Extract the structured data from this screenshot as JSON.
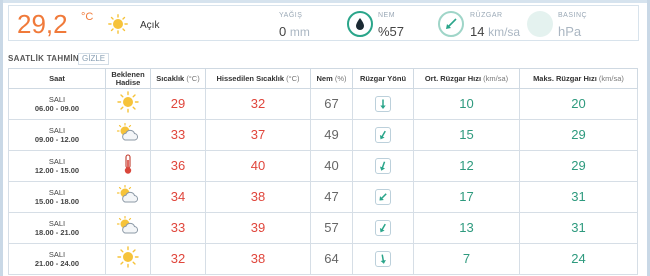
{
  "current": {
    "temperature": "29,2",
    "unit": "°C",
    "condition": "Açık",
    "rain": {
      "label": "YAĞIŞ",
      "value": "0",
      "unit": "mm"
    },
    "humidity": {
      "label": "NEM",
      "value": "%57"
    },
    "wind": {
      "label": "RÜZGAR",
      "value": "14",
      "unit": "km/sa"
    },
    "pressure": {
      "label": "BASINÇ",
      "value": "hPa"
    }
  },
  "forecast": {
    "title": "SAATLİK TAHMİN",
    "hide_label": "GİZLE",
    "headers": {
      "time": "Saat",
      "event_line1": "Beklenen",
      "event_line2": "Hadise",
      "temp": "Sıcaklık",
      "temp_unit": "(°C)",
      "feels": "Hissedilen Sıcaklık",
      "feels_unit": "(°C)",
      "humidity": "Nem",
      "humidity_unit": "(%)",
      "wind_dir": "Rüzgar Yönü",
      "avg_wind": "Ort. Rüzgar Hızı",
      "avg_wind_unit": "(km/sa)",
      "max_wind": "Maks. Rüzgar Hızı",
      "max_wind_unit": "(km/sa)"
    },
    "rows": [
      {
        "day": "SALI",
        "time": "06.00 - 09.00",
        "icon": "sun-icon",
        "temp": "29",
        "feels": "32",
        "humidity": "67",
        "wind_dir_deg": 180,
        "avg": "10",
        "max": "20"
      },
      {
        "day": "SALI",
        "time": "09.00 - 12.00",
        "icon": "partly-cloudy-icon",
        "temp": "33",
        "feels": "37",
        "humidity": "49",
        "wind_dir_deg": 210,
        "avg": "15",
        "max": "29"
      },
      {
        "day": "SALI",
        "time": "12.00 - 15.00",
        "icon": "thermometer-icon",
        "temp": "36",
        "feels": "40",
        "humidity": "40",
        "wind_dir_deg": 200,
        "avg": "12",
        "max": "29"
      },
      {
        "day": "SALI",
        "time": "15.00 - 18.00",
        "icon": "partly-cloudy-icon",
        "temp": "34",
        "feels": "38",
        "humidity": "47",
        "wind_dir_deg": 225,
        "avg": "17",
        "max": "31"
      },
      {
        "day": "SALI",
        "time": "18.00 - 21.00",
        "icon": "partly-cloudy-icon",
        "temp": "33",
        "feels": "39",
        "humidity": "57",
        "wind_dir_deg": 210,
        "avg": "13",
        "max": "31"
      },
      {
        "day": "SALI",
        "time": "21.00 - 24.00",
        "icon": "sun-icon",
        "temp": "32",
        "feels": "38",
        "humidity": "64",
        "wind_dir_deg": 170,
        "avg": "7",
        "max": "24"
      }
    ]
  }
}
